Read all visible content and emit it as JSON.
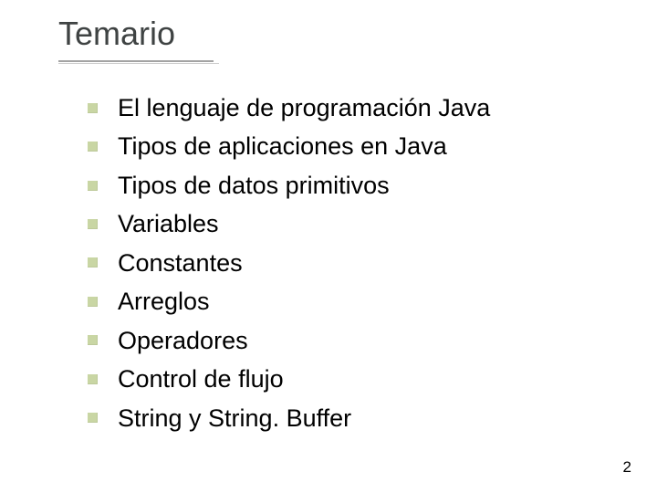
{
  "title": "Temario",
  "items": [
    "El lenguaje de programación Java",
    "Tipos de aplicaciones en Java",
    "Tipos de datos primitivos",
    "Variables",
    "Constantes",
    "Arreglos",
    "Operadores",
    "Control de flujo",
    "String y String. Buffer"
  ],
  "page_number": "2"
}
